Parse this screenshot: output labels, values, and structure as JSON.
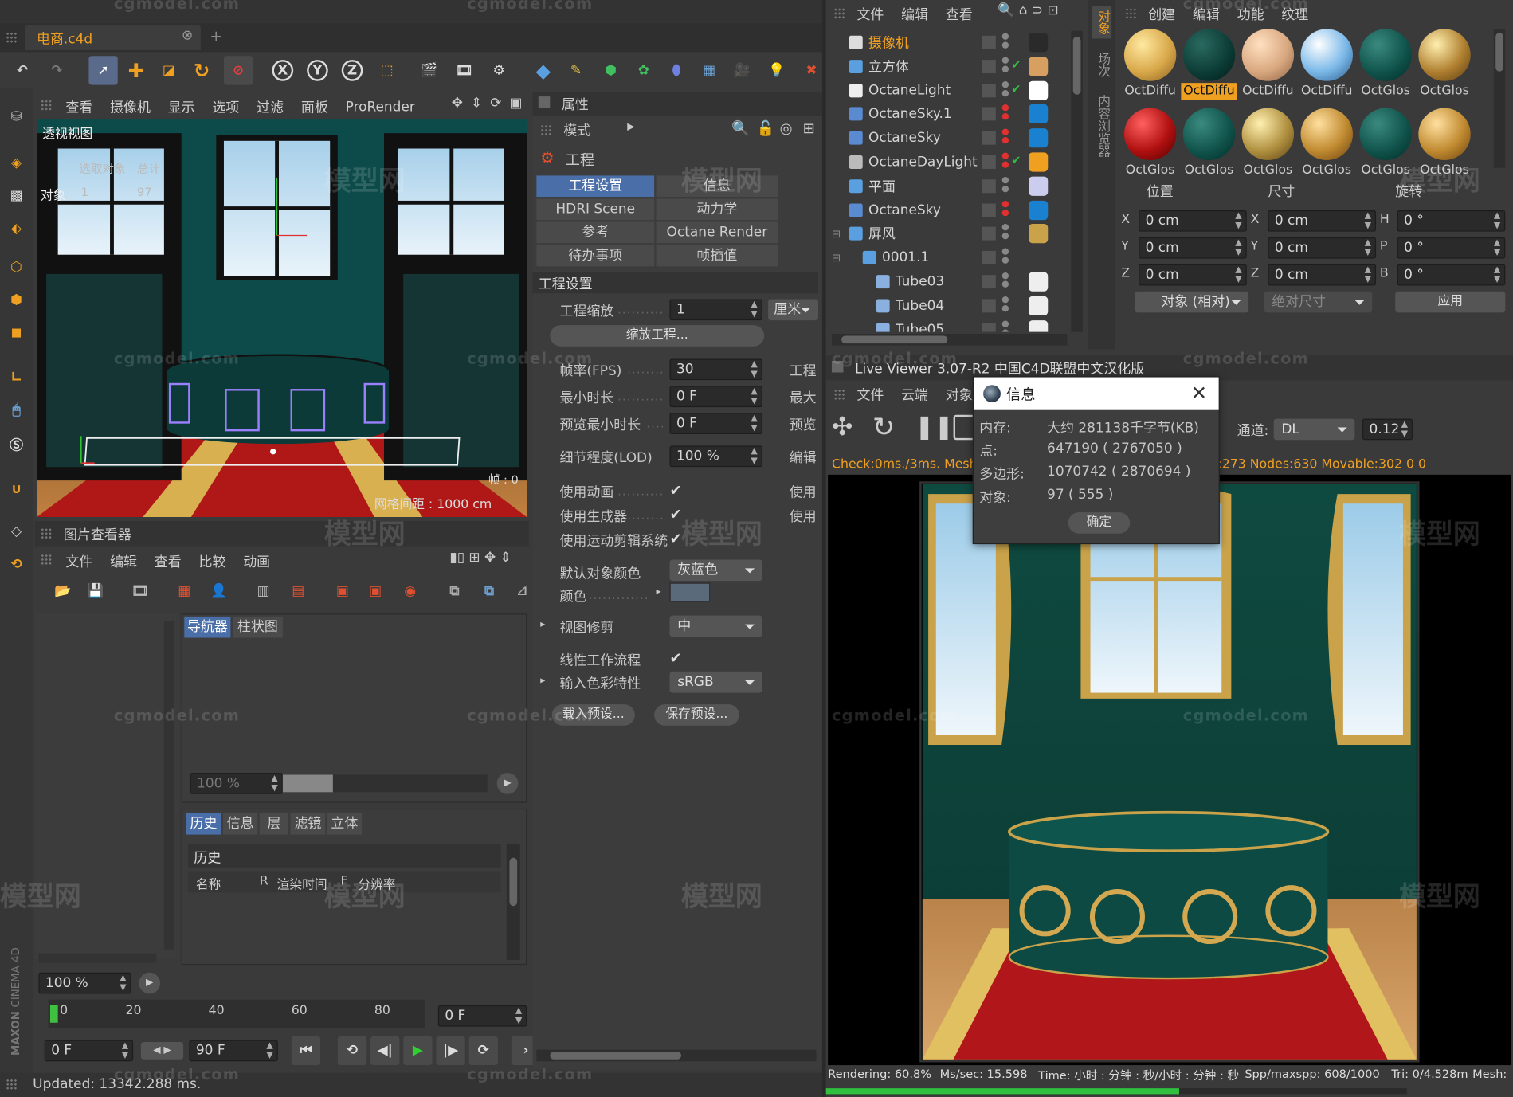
{
  "file_tab": {
    "title": "电商.c4d"
  },
  "viewport": {
    "menu": [
      "查看",
      "摄像机",
      "显示",
      "选项",
      "过滤",
      "面板",
      "ProRender"
    ],
    "label": "透视视图",
    "hud_select": "选取对象",
    "hud_total": "总计",
    "hud_obj": "对象",
    "hud_obj_a": "1",
    "hud_obj_b": "97",
    "frame": "帧 : 0",
    "grid": "网格间距 : 1000 cm"
  },
  "toolbar": {
    "axis_x": "X",
    "axis_y": "Y",
    "axis_z": "Z"
  },
  "picture_viewer": {
    "title": "图片查看器",
    "menu": [
      "文件",
      "编辑",
      "查看",
      "比较",
      "动画"
    ],
    "tabs": [
      "导航器",
      "柱状图"
    ],
    "zoom": "100 %",
    "bottom_tabs": [
      "历史",
      "信息",
      "层",
      "滤镜",
      "立体"
    ],
    "history_title": "历史",
    "columns": [
      "名称",
      "R",
      "渲染时间",
      "F",
      "分辨率"
    ]
  },
  "timeline": {
    "zoom": "100 %",
    "ticks": [
      "0",
      "20",
      "40",
      "60",
      "80"
    ],
    "frame_field": "0 F",
    "start": "0 F",
    "end": "90 F"
  },
  "status": {
    "updated": "Updated: 13342.288 ms."
  },
  "attributes": {
    "title": "属性",
    "mode": "模式",
    "section": "工程",
    "tabs": [
      "工程设置",
      "信息",
      "HDRI Scene Hook",
      "动力学",
      "参考",
      "Octane Render",
      "待办事项",
      "帧插值"
    ],
    "group": "工程设置",
    "scale_label": "工程缩放",
    "scale_value": "1",
    "scale_unit": "厘米",
    "scale_btn": "缩放工程...",
    "fps_label": "帧率(FPS)",
    "fps_value": "30",
    "fps_right": "工程",
    "min_label": "最小时长",
    "min_value": "0 F",
    "min_right": "最大",
    "prev_label": "预览最小时长",
    "prev_value": "0 F",
    "prev_right": "预览",
    "lod_label": "细节程度(LOD)",
    "lod_value": "100 %",
    "lod_right": "编辑",
    "anim_label": "使用动画",
    "anim_right": "使用",
    "gen_label": "使用生成器",
    "gen_right": "使用",
    "clip_label": "使用运动剪辑系统",
    "color_label": "默认对象颜色",
    "color_value": "灰蓝色",
    "swatch_label": "颜色",
    "clip2_label": "视图修剪",
    "clip2_value": "中",
    "linear_label": "线性工作流程",
    "cs_label": "输入色彩特性",
    "cs_value": "sRGB",
    "load_btn": "载入预设...",
    "save_btn": "保存预设..."
  },
  "objects": {
    "side_tabs": [
      "对象",
      "场次",
      "内容浏览器"
    ],
    "items": [
      {
        "name": "摄像机"
      },
      {
        "name": "立方体"
      },
      {
        "name": "OctaneLight"
      },
      {
        "name": "OctaneSky.1"
      },
      {
        "name": "OctaneSky"
      },
      {
        "name": "OctaneDayLight"
      },
      {
        "name": "平面"
      },
      {
        "name": "OctaneSky"
      },
      {
        "name": "屏风"
      },
      {
        "name": "0001.1"
      },
      {
        "name": "Tube03"
      },
      {
        "name": "Tube04"
      },
      {
        "name": "Tube05"
      }
    ]
  },
  "materials": {
    "menu": [
      "创建",
      "编辑",
      "功能",
      "纹理"
    ],
    "row1": [
      "OctDiffu",
      "OctDiffu",
      "OctDiffu",
      "OctDiffu",
      "OctGlos",
      "OctGlos"
    ],
    "row2": [
      "OctGlos",
      "OctGlos",
      "OctGlos",
      "OctGlos",
      "OctGlos",
      "OctGlos"
    ]
  },
  "coords": {
    "headers": [
      "位置",
      "尺寸",
      "旋转"
    ],
    "rows": [
      {
        "a": "X",
        "av": "0 cm",
        "b": "X",
        "bv": "0 cm",
        "c": "H",
        "cv": "0 °"
      },
      {
        "a": "Y",
        "av": "0 cm",
        "b": "Y",
        "bv": "0 cm",
        "c": "P",
        "cv": "0 °"
      },
      {
        "a": "Z",
        "av": "0 cm",
        "b": "Z",
        "bv": "0 cm",
        "c": "B",
        "cv": "0 °"
      }
    ],
    "mode": "对象 (相对)",
    "size_mode": "绝对尺寸",
    "apply": "应用"
  },
  "live_viewer": {
    "title": "Live Viewer 3.07-R2 中国C4D联盟中文汉化版",
    "menu": [
      "文件",
      "云端",
      "对象"
    ],
    "channel_label": "通道:",
    "channel": "DL",
    "value": "0.12",
    "stats_left": "Check:0ms./3ms. Mesh",
    "stats_right": ":273 Nodes:630 Movable:302  0 0",
    "bottom": {
      "rendering": "Rendering: 60.8%",
      "ms": "Ms/sec: 15.598",
      "time": "Time: 小时 : 分钟 : 秒/小时 : 分钟 : 秒",
      "spp": "Spp/maxspp: 608/1000",
      "tri": "Tri: 0/4.528m",
      "mesh": "Mesh:"
    },
    "progress": 0.608
  },
  "dialog": {
    "title": "信息",
    "rows": [
      {
        "k": "内存:",
        "v": "大约 281138千字节(KB)"
      },
      {
        "k": "点:",
        "v": "647190 ( 2767050 )"
      },
      {
        "k": "多边形:",
        "v": "1070742 ( 2870694 )"
      },
      {
        "k": "对象:",
        "v": "97 ( 555 )"
      }
    ],
    "ok": "确定"
  },
  "watermark": {
    "domain": "cgmodel.com",
    "brand": "模型网"
  },
  "branding": {
    "vendor": "MAXON",
    "product": "CINEMA 4D"
  }
}
